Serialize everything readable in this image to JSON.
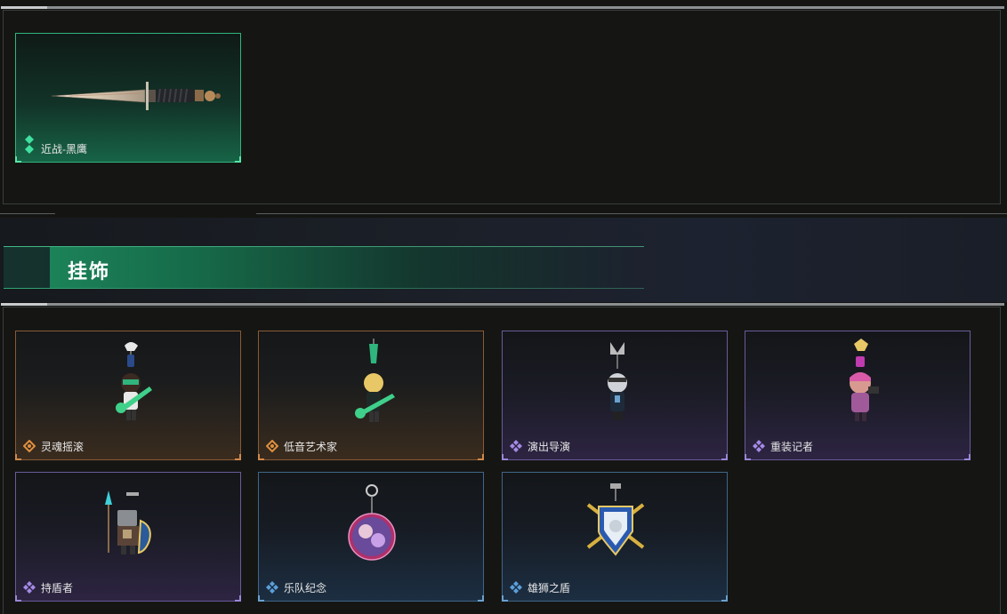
{
  "weapons": {
    "items": [
      {
        "name": "近战-黑鹰",
        "rarity": "green",
        "icon": "knife-icon"
      }
    ]
  },
  "charms_section": {
    "title": "挂饰"
  },
  "charms": {
    "items": [
      {
        "name": "灵魂摇滚",
        "rarity": "orange",
        "icon": "guitar-rocker-charm-icon"
      },
      {
        "name": "低音艺术家",
        "rarity": "orange",
        "icon": "bass-artist-charm-icon"
      },
      {
        "name": "演出导演",
        "rarity": "purple",
        "icon": "stage-director-charm-icon"
      },
      {
        "name": "重装记者",
        "rarity": "purple",
        "icon": "heavy-reporter-charm-icon"
      },
      {
        "name": "持盾者",
        "rarity": "purple",
        "icon": "shield-bearer-charm-icon"
      },
      {
        "name": "乐队纪念",
        "rarity": "blue",
        "icon": "band-badge-charm-icon"
      },
      {
        "name": "雄狮之盾",
        "rarity": "blue",
        "icon": "lion-shield-charm-icon"
      }
    ]
  },
  "colors": {
    "green": "#2fb57d",
    "orange": "#d0894a",
    "purple": "#9a86d8",
    "blue": "#6aa2d0"
  }
}
